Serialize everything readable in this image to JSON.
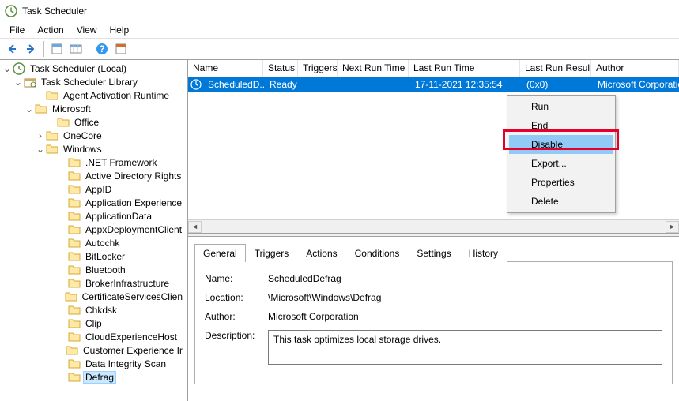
{
  "window": {
    "title": "Task Scheduler"
  },
  "menu": {
    "file": "File",
    "action": "Action",
    "view": "View",
    "help": "Help"
  },
  "tree": {
    "root": "Task Scheduler (Local)",
    "library": "Task Scheduler Library",
    "items": [
      "Agent Activation Runtime",
      "Microsoft",
      "Office",
      "OneCore",
      "Windows",
      ".NET Framework",
      "Active Directory Rights",
      "AppID",
      "Application Experience",
      "ApplicationData",
      "AppxDeploymentClient",
      "Autochk",
      "BitLocker",
      "Bluetooth",
      "BrokerInfrastructure",
      "CertificateServicesClien",
      "Chkdsk",
      "Clip",
      "CloudExperienceHost",
      "Customer Experience Ir",
      "Data Integrity Scan",
      "Defrag"
    ]
  },
  "columns": {
    "name": "Name",
    "status": "Status",
    "triggers": "Triggers",
    "next": "Next Run Time",
    "last": "Last Run Time",
    "result": "Last Run Result",
    "author": "Author"
  },
  "task": {
    "name": "ScheduledD...",
    "status": "Ready",
    "last": "17-11-2021 12:35:54",
    "result": "(0x0)",
    "author": "Microsoft Corporatio"
  },
  "ctx": {
    "run": "Run",
    "end": "End",
    "disable": "Disable",
    "export": "Export...",
    "properties": "Properties",
    "delete": "Delete"
  },
  "tabs": {
    "general": "General",
    "triggers": "Triggers",
    "actions": "Actions",
    "conditions": "Conditions",
    "settings": "Settings",
    "history": "History"
  },
  "detail": {
    "name_lbl": "Name:",
    "name_val": "ScheduledDefrag",
    "loc_lbl": "Location:",
    "loc_val": "\\Microsoft\\Windows\\Defrag",
    "auth_lbl": "Author:",
    "auth_val": "Microsoft Corporation",
    "desc_lbl": "Description:",
    "desc_val": "This task optimizes local storage drives."
  }
}
